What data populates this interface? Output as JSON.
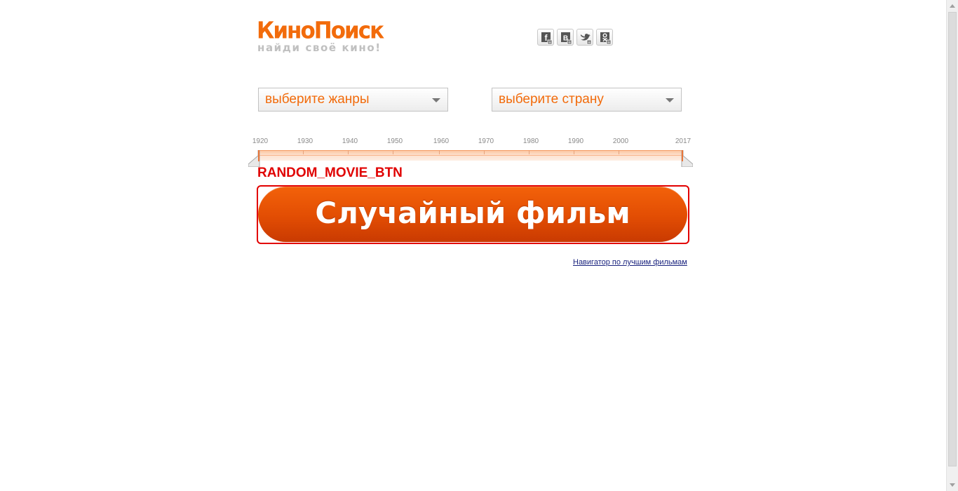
{
  "logo": {
    "name": "КиноПоиск",
    "tagline": "найди своё кино!"
  },
  "social": [
    {
      "icon": "facebook-icon",
      "glyph": "f"
    },
    {
      "icon": "vkontakte-icon",
      "glyph": "В"
    },
    {
      "icon": "twitter-icon",
      "glyph": ""
    },
    {
      "icon": "odnoklassniki-icon",
      "glyph": ""
    }
  ],
  "filters": {
    "genre_label": "выберите жанры",
    "country_label": "выберите страну"
  },
  "timeline": {
    "years": [
      "1920",
      "1930",
      "1940",
      "1950",
      "1960",
      "1970",
      "1980",
      "1990",
      "2000",
      "2017"
    ]
  },
  "annotation": {
    "label": "RANDOM_MOVIE_BTN"
  },
  "random_button": {
    "label": "Случайный фильм"
  },
  "navigator_link": {
    "label": "Навигатор по лучшим фильмам"
  },
  "colors": {
    "accent": "#f26b0b",
    "button": "#e24d03",
    "annotation": "#e00000"
  }
}
